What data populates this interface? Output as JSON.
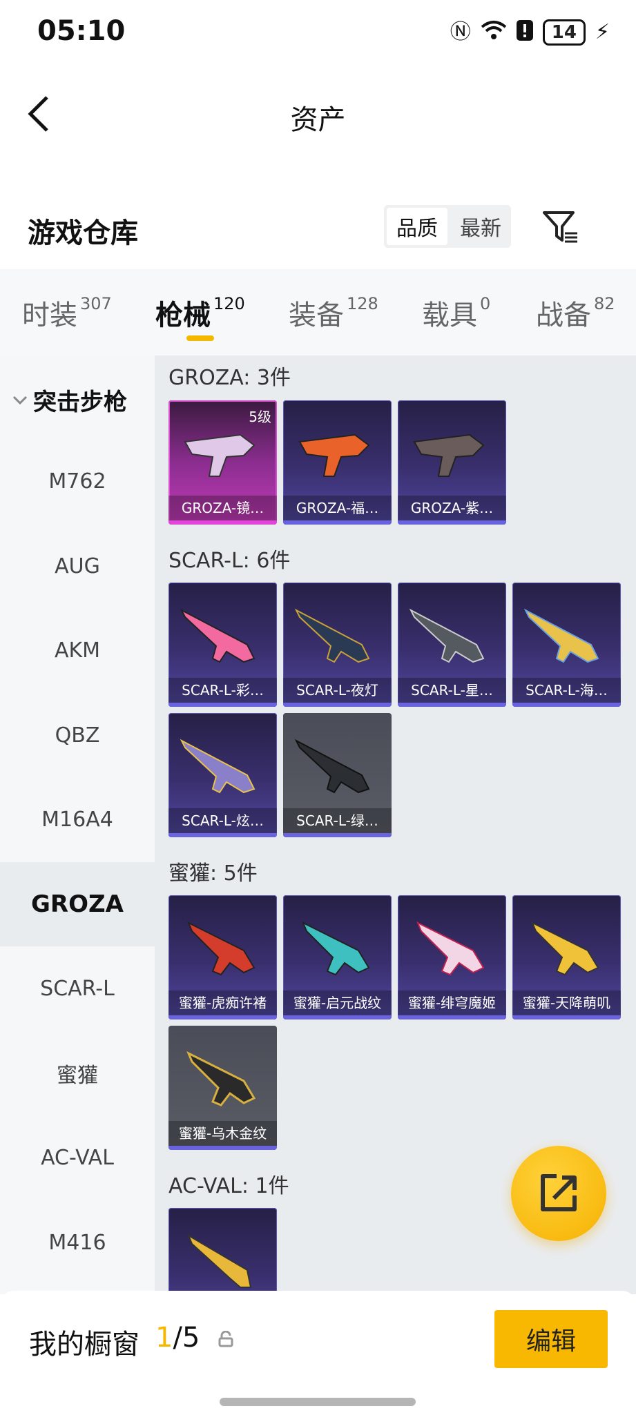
{
  "status_bar": {
    "time": "05:10",
    "battery": "14"
  },
  "header": {
    "title": "资产"
  },
  "warehouse": {
    "title": "游戏仓库",
    "sort_options": [
      "品质",
      "最新"
    ],
    "active_sort": "品质"
  },
  "tabs": [
    {
      "label": "时装",
      "count": "307"
    },
    {
      "label": "枪械",
      "count": "120"
    },
    {
      "label": "装备",
      "count": "128"
    },
    {
      "label": "载具",
      "count": "0"
    },
    {
      "label": "战备",
      "count": "82"
    }
  ],
  "active_tab": "枪械",
  "sidebar": {
    "group": "突击步枪",
    "items": [
      "M762",
      "AUG",
      "AKM",
      "QBZ",
      "M16A4",
      "GROZA",
      "SCAR-L",
      "蜜獾",
      "AC-VAL",
      "M416"
    ],
    "active": "GROZA"
  },
  "sections": [
    {
      "title": "GROZA: 3件",
      "items": [
        {
          "name": "GROZA-镜…",
          "level": "5级",
          "rarity": "pink"
        },
        {
          "name": "GROZA-福…",
          "rarity": "purple"
        },
        {
          "name": "GROZA-紫…",
          "rarity": "purple"
        }
      ]
    },
    {
      "title": "SCAR-L: 6件",
      "items": [
        {
          "name": "SCAR-L-彩…",
          "rarity": "purple"
        },
        {
          "name": "SCAR-L-夜灯",
          "rarity": "purple"
        },
        {
          "name": "SCAR-L-星…",
          "rarity": "purple"
        },
        {
          "name": "SCAR-L-海…",
          "rarity": "purple"
        },
        {
          "name": "SCAR-L-炫…",
          "rarity": "purple"
        },
        {
          "name": "SCAR-L-绿…",
          "rarity": "grey"
        }
      ]
    },
    {
      "title": "蜜獾: 5件",
      "items": [
        {
          "name": "蜜獾-虎痴许褚",
          "rarity": "purple"
        },
        {
          "name": "蜜獾-启元战纹",
          "rarity": "purple"
        },
        {
          "name": "蜜獾-绯穹魔姬",
          "rarity": "purple"
        },
        {
          "name": "蜜獾-天降萌叽",
          "rarity": "purple"
        },
        {
          "name": "蜜獾-乌木金纹",
          "rarity": "grey"
        }
      ]
    },
    {
      "title": "AC-VAL: 1件",
      "items": [
        {
          "name": "",
          "rarity": "purple"
        }
      ]
    }
  ],
  "showcase": {
    "label": "我的橱窗",
    "current": "1",
    "total": "/5",
    "edit_label": "编辑"
  },
  "colors": {
    "accent": "#f5b800",
    "purple_card": "#3a2f6e",
    "pink_card": "#c43cb8",
    "grey_card": "#5a5d66"
  }
}
